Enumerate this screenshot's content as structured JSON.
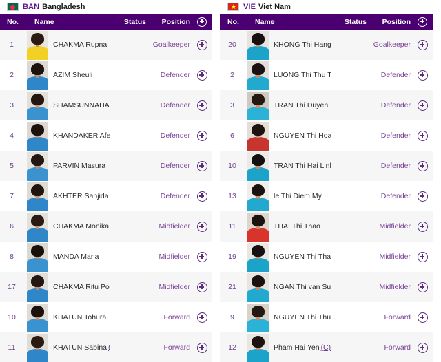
{
  "columns": {
    "no": "No.",
    "name": "Name",
    "status": "Status",
    "position": "Position",
    "add_icon": "plus-circle-icon"
  },
  "colors": {
    "header_purple": "#4b0072",
    "accent_purple": "#7b4397",
    "number_purple": "#6b3f8f",
    "row_alt": "#f6f6f6",
    "ban_flag_green": "#006a4e",
    "ban_flag_red": "#f42a41",
    "vie_flag_red": "#da251d",
    "vie_flag_yellow": "#ffff00"
  },
  "teams": [
    {
      "code": "BAN",
      "name": "Bangladesh",
      "flag": "bangladesh-flag-icon",
      "players": [
        {
          "no": "1",
          "name": "CHAKMA Rupna",
          "captain": "",
          "status": "",
          "position": "Goalkeeper",
          "kit": "#f2d024",
          "hair": "#2b1a12",
          "bg": "#e9e5e0"
        },
        {
          "no": "2",
          "name": "AZIM Sheuli",
          "captain": "",
          "status": "",
          "position": "Defender",
          "kit": "#2f86c8",
          "hair": "#1e120c",
          "bg": "#dcd8d3"
        },
        {
          "no": "3",
          "name": "SHAMSUNNAHAR",
          "captain": "",
          "status": "",
          "position": "Defender",
          "kit": "#3a93cf",
          "hair": "#241610",
          "bg": "#e3dfd9"
        },
        {
          "no": "4",
          "name": "KHANDAKER Afeida",
          "captain": "",
          "status": "",
          "position": "Defender",
          "kit": "#2f86c8",
          "hair": "#1c110b",
          "bg": "#ddd9d2"
        },
        {
          "no": "5",
          "name": "PARVIN Masura",
          "captain": "",
          "status": "",
          "position": "Defender",
          "kit": "#3a93cf",
          "hair": "#241610",
          "bg": "#e6e2dc"
        },
        {
          "no": "7",
          "name": "AKHTER Sanjida",
          "captain": "",
          "status": "",
          "position": "Defender",
          "kit": "#2f86c8",
          "hair": "#20140d",
          "bg": "#dedad4"
        },
        {
          "no": "6",
          "name": "CHAKMA Monika",
          "captain": "",
          "status": "",
          "position": "Midfielder",
          "kit": "#2f86c8",
          "hair": "#2b1a12",
          "bg": "#e4e0da"
        },
        {
          "no": "8",
          "name": "MANDA Maria",
          "captain": "",
          "status": "",
          "position": "Midfielder",
          "kit": "#3a93cf",
          "hair": "#1a100a",
          "bg": "#dbd7d1"
        },
        {
          "no": "17",
          "name": "CHAKMA Ritu Porna",
          "captain": "",
          "status": "",
          "position": "Midfielder",
          "kit": "#2f86c8",
          "hair": "#241610",
          "bg": "#e2ded8"
        },
        {
          "no": "10",
          "name": "KHATUN Tohura",
          "captain": "",
          "status": "",
          "position": "Forward",
          "kit": "#3a93cf",
          "hair": "#1c110b",
          "bg": "#dfdbd5"
        },
        {
          "no": "11",
          "name": "KHATUN Sabina",
          "captain": "(C)",
          "status": "",
          "position": "Forward",
          "kit": "#2f86c8",
          "hair": "#2b1a12",
          "bg": "#e0dcd6"
        }
      ]
    },
    {
      "code": "VIE",
      "name": "Viet Nam",
      "flag": "vietnam-flag-icon",
      "players": [
        {
          "no": "20",
          "name": "KHONG Thi Hang",
          "captain": "",
          "status": "",
          "position": "Goalkeeper",
          "kit": "#1ba3c9",
          "hair": "#181010",
          "bg": "#e7e3de"
        },
        {
          "no": "2",
          "name": "LUONG Thi Thu Thuong",
          "captain": "",
          "status": "",
          "position": "Defender",
          "kit": "#21a9cf",
          "hair": "#1a1210",
          "bg": "#e2ded9"
        },
        {
          "no": "3",
          "name": "TRAN Thi Duyen",
          "captain": "",
          "status": "",
          "position": "Defender",
          "kit": "#2bb2d6",
          "hair": "#241812",
          "bg": "#cfc9c1"
        },
        {
          "no": "6",
          "name": "NGUYEN Thi Hoa",
          "captain": "",
          "status": "",
          "position": "Defender",
          "kit": "#c8342e",
          "hair": "#1d1310",
          "bg": "#e6ded6"
        },
        {
          "no": "10",
          "name": "TRAN Thi Hai Linh",
          "captain": "",
          "status": "",
          "position": "Defender",
          "kit": "#1ba3c9",
          "hair": "#151010",
          "bg": "#eceae6"
        },
        {
          "no": "13",
          "name": "le Thi Diem My",
          "captain": "",
          "status": "",
          "position": "Defender",
          "kit": "#21a9cf",
          "hair": "#1a1210",
          "bg": "#f0eeeb"
        },
        {
          "no": "11",
          "name": "THAI Thi Thao",
          "captain": "",
          "status": "",
          "position": "Midfielder",
          "kit": "#d9342c",
          "hair": "#1c1310",
          "bg": "#ded6cc"
        },
        {
          "no": "19",
          "name": "NGUYEN Thi Thanh Nha",
          "captain": "",
          "status": "",
          "position": "Midfielder",
          "kit": "#1ba3c9",
          "hair": "#181010",
          "bg": "#eae7e3"
        },
        {
          "no": "21",
          "name": "NGAN Thi van Su",
          "captain": "",
          "status": "",
          "position": "Midfielder",
          "kit": "#21a9cf",
          "hair": "#1a1210",
          "bg": "#e8e5e1"
        },
        {
          "no": "9",
          "name": "NGUYEN Thi Thuy Hang",
          "captain": "",
          "status": "",
          "position": "Forward",
          "kit": "#2bb2d6",
          "hair": "#241812",
          "bg": "#d8d2c9"
        },
        {
          "no": "12",
          "name": "Pham Hai Yen",
          "captain": "(C)",
          "status": "",
          "position": "Forward",
          "kit": "#1ba3c9",
          "hair": "#1c1310",
          "bg": "#e9e6e2"
        }
      ]
    }
  ]
}
